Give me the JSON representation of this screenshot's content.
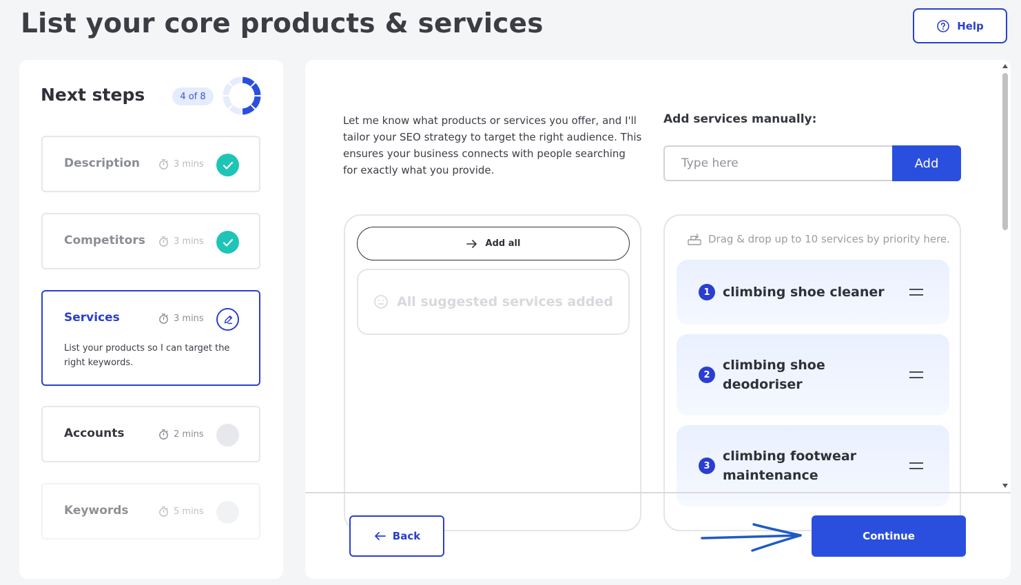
{
  "page": {
    "title": "List your core products & services"
  },
  "help": {
    "label": "Help"
  },
  "sidebar": {
    "title": "Next steps",
    "progress_label": "4 of 8",
    "progress": {
      "current": 4,
      "total": 8
    },
    "steps": [
      {
        "name": "Description",
        "time": "3 mins",
        "status": "done"
      },
      {
        "name": "Competitors",
        "time": "3 mins",
        "status": "done"
      },
      {
        "name": "Services",
        "time": "3 mins",
        "status": "active",
        "description": "List your products so I can target the right keywords."
      },
      {
        "name": "Accounts",
        "time": "2 mins",
        "status": "pending"
      },
      {
        "name": "Keywords",
        "time": "5 mins",
        "status": "pending"
      }
    ]
  },
  "main": {
    "intro": "Let me know what products or services you offer, and I'll tailor your SEO strategy to target the right audience. This ensures your business connects with people searching for exactly what you provide.",
    "manual": {
      "label": "Add services manually:",
      "placeholder": "Type here",
      "value": "",
      "add_label": "Add"
    },
    "suggested": {
      "add_all_label": "Add all",
      "empty_text": "All suggested services added"
    },
    "priority": {
      "hint": "Drag & drop up to 10 services by priority here.",
      "items": [
        {
          "rank": "1",
          "label": "climbing shoe cleaner"
        },
        {
          "rank": "2",
          "label": "climbing shoe deodoriser"
        },
        {
          "rank": "3",
          "label": "climbing footwear maintenance"
        }
      ]
    }
  },
  "footer": {
    "back_label": "Back",
    "continue_label": "Continue"
  },
  "colors": {
    "primary": "#2a4fde",
    "done": "#1ec5b6",
    "annotation": "#1f5bc4"
  }
}
